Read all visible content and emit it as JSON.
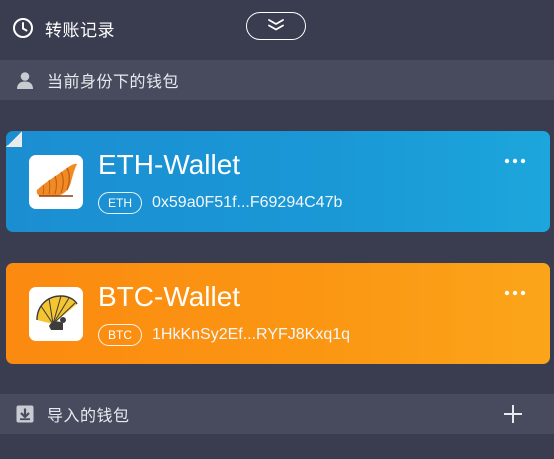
{
  "header": {
    "history_label": "转账记录",
    "history_icon": "clock-icon",
    "collapse_icon": "double-chevron-down-icon"
  },
  "current_section": {
    "label": "当前身份下的钱包",
    "icon": "person-icon"
  },
  "wallets": [
    {
      "name": "ETH-Wallet",
      "coin": "ETH",
      "address": "0x59a0F51f...F69294C47b",
      "logo": "seashell-logo",
      "color": "#1b8ed2"
    },
    {
      "name": "BTC-Wallet",
      "coin": "BTC",
      "address": "1HkKnSy2Ef...RYFJ8Kxq1q",
      "logo": "umbrella-shell-logo",
      "color": "#fb8a10"
    }
  ],
  "imported_section": {
    "label": "导入的钱包",
    "icon": "import-download-icon",
    "add_icon": "plus-icon"
  },
  "colors": {
    "background": "#393d4f",
    "section_bar": "#474b5d",
    "eth_card": "#1b8ed2",
    "btc_card": "#fb8a10"
  }
}
